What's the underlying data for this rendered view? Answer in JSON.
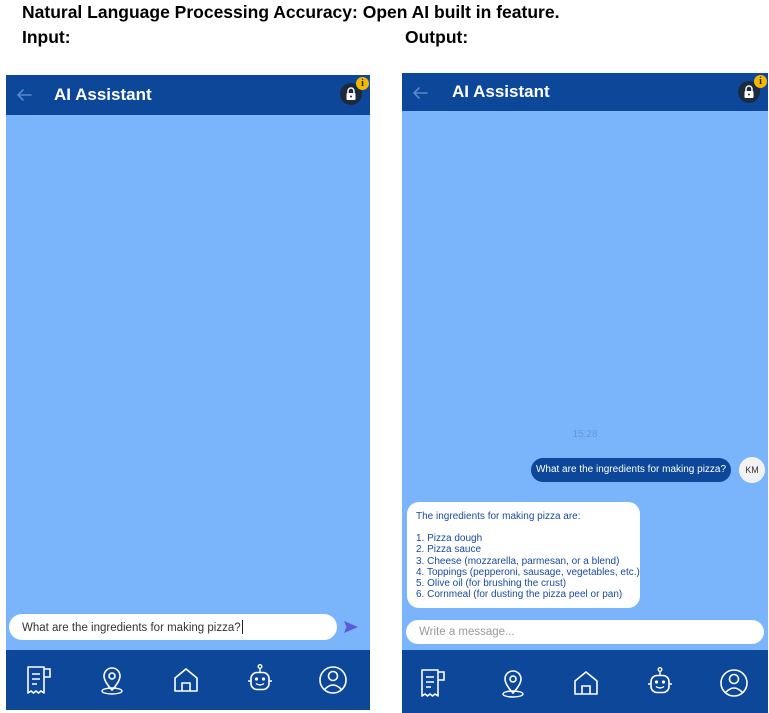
{
  "caption": {
    "title": "Natural Language Processing Accuracy: Open AI built in feature.",
    "input_label": "Input:",
    "output_label": "Output:"
  },
  "app": {
    "title": "AI Assistant",
    "info_badge": "i"
  },
  "input_screen": {
    "input_value": "What are the ingredients for making pizza?"
  },
  "output_screen": {
    "timestamp": "15:28",
    "user_message": "What are the ingredients for making pizza?",
    "user_initials": "KM",
    "bot_intro": "The ingredients for making pizza are:",
    "bot_items": [
      "1. Pizza dough",
      "2. Pizza sauce",
      "3. Cheese (mozzarella, parmesan, or a blend)",
      "4. Toppings (pepperoni, sausage, vegetables, etc.)",
      "5. Olive oil (for brushing the crust)",
      "6. Cornmeal (for dusting the pizza peel or pan)"
    ],
    "input_placeholder": "Write a message..."
  },
  "nav": {
    "items": [
      "receipt-icon",
      "location-icon",
      "home-icon",
      "robot-icon",
      "profile-icon"
    ]
  },
  "colors": {
    "app_bar": "#0c4799",
    "chat_background": "#7ab4fb",
    "info_badge": "#f5b800",
    "send_icon": "#5b5bd6"
  }
}
